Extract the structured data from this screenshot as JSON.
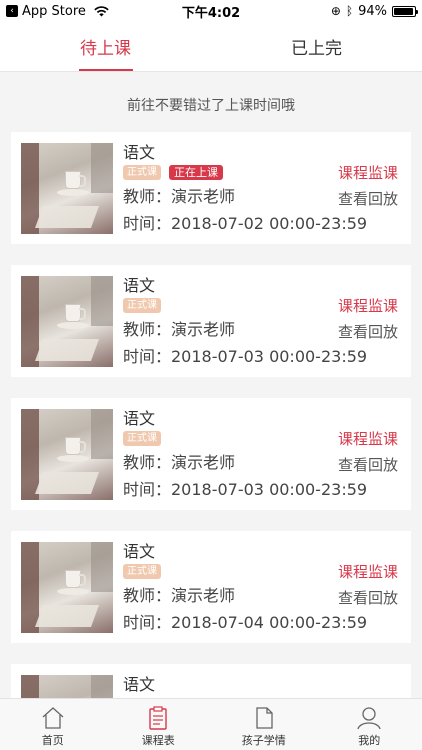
{
  "status_bar": {
    "carrier": "App Store",
    "time": "下午4:02",
    "battery": "94%",
    "battery_level": 0.94
  },
  "tabs": [
    {
      "label": "待上课",
      "active": true
    },
    {
      "label": "已上完",
      "active": false
    }
  ],
  "hint": "前往不要错过了上课时间哦",
  "cards": [
    {
      "subject": "语文",
      "tag_formal": "正式课",
      "tag_live": "正在上课",
      "teacher": "教师：演示老师",
      "time": "时间：2018-07-02 00:00-23:59",
      "monitor": "课程监课",
      "replay": "查看回放"
    },
    {
      "subject": "语文",
      "tag_formal": "正式课",
      "tag_live": "",
      "teacher": "教师：演示老师",
      "time": "时间：2018-07-03 00:00-23:59",
      "monitor": "课程监课",
      "replay": "查看回放"
    },
    {
      "subject": "语文",
      "tag_formal": "正式课",
      "tag_live": "",
      "teacher": "教师：演示老师",
      "time": "时间：2018-07-03 00:00-23:59",
      "monitor": "课程监课",
      "replay": "查看回放"
    },
    {
      "subject": "语文",
      "tag_formal": "正式课",
      "tag_live": "",
      "teacher": "教师：演示老师",
      "time": "时间：2018-07-04 00:00-23:59",
      "monitor": "课程监课",
      "replay": "查看回放"
    },
    {
      "subject": "语文"
    }
  ],
  "bottom_nav": [
    {
      "label": "首页",
      "icon": "home-icon"
    },
    {
      "label": "课程表",
      "icon": "schedule-icon"
    },
    {
      "label": "孩子学情",
      "icon": "document-icon"
    },
    {
      "label": "我的",
      "icon": "user-icon"
    }
  ],
  "colors": {
    "accent": "#d7394a",
    "tag_formal": "#f0c8ad",
    "background": "#f4f4f4"
  }
}
